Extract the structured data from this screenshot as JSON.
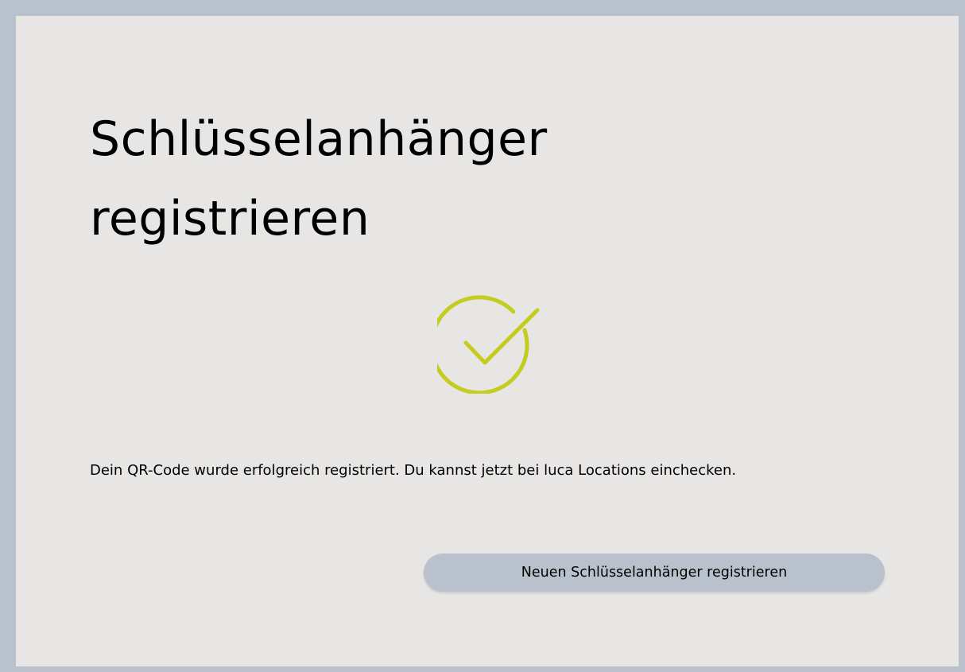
{
  "page": {
    "title": "Schlüsselanhänger registrieren",
    "success_icon": "check-circle-icon",
    "message": "Dein QR-Code wurde erfolgreich registriert. Du kannst jetzt bei luca Locations einchecken.",
    "button_label": "Neuen Schlüsselanhänger registrieren"
  },
  "colors": {
    "background": "#e8e6e5",
    "border": "#b8c1cc",
    "accent": "#c3cd1f",
    "button": "#b8c1cc"
  }
}
